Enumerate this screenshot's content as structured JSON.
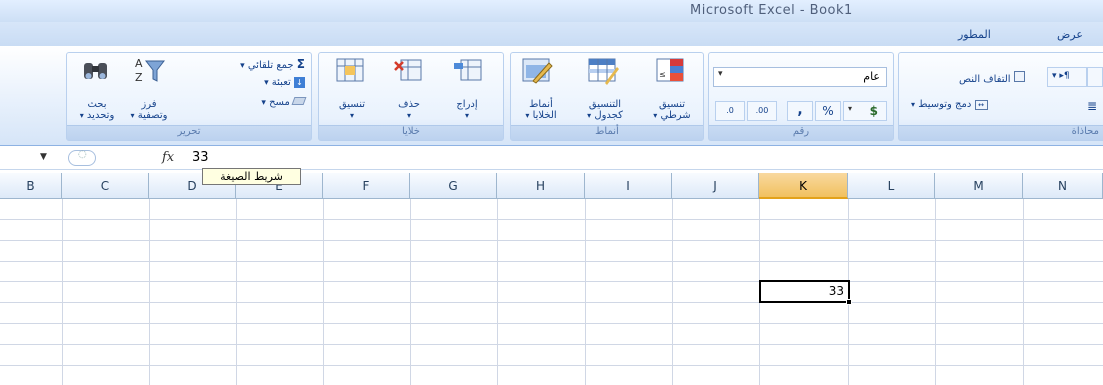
{
  "window": {
    "title": "Microsoft Excel - Book1"
  },
  "tabs": [
    {
      "label": "عرض"
    },
    {
      "label": "المطور"
    }
  ],
  "ribbon": {
    "editing": {
      "label": "تحرير",
      "autosum": "جمع تلقائي",
      "fill": "تعبئة",
      "clear": "مسح",
      "sort_filter_1": "فرز",
      "sort_filter_2": "وتصفية",
      "find_select_1": "بحث",
      "find_select_2": "وتحديد"
    },
    "cells": {
      "label": "خلايا",
      "format": "تنسيق",
      "delete": "حذف",
      "insert": "إدراج"
    },
    "styles": {
      "label": "أنماط",
      "cell_styles_1": "أنماط",
      "cell_styles_2": "الخلايا",
      "format_table_1": "التنسيق",
      "format_table_2": "كجدول",
      "conditional_1": "تنسيق",
      "conditional_2": "شرطي"
    },
    "number": {
      "label": "رقم",
      "format_value": "عام",
      "currency": "$",
      "percent": "%",
      "comma": ",",
      "inc_decimal": ".00 →.0",
      "dec_decimal": ".0 →.00"
    },
    "alignment": {
      "label": "محاذاة",
      "wrap_text": "التفاف النص",
      "merge_center": "دمج وتوسيط"
    }
  },
  "formula_bar": {
    "fx": "fx",
    "value": "33",
    "tooltip": "شريط الصيغة"
  },
  "columns": [
    "B",
    "C",
    "D",
    "E",
    "F",
    "G",
    "H",
    "I",
    "J",
    "K",
    "L",
    "M",
    "N"
  ],
  "active_cell": {
    "column": "K",
    "value": "33"
  }
}
